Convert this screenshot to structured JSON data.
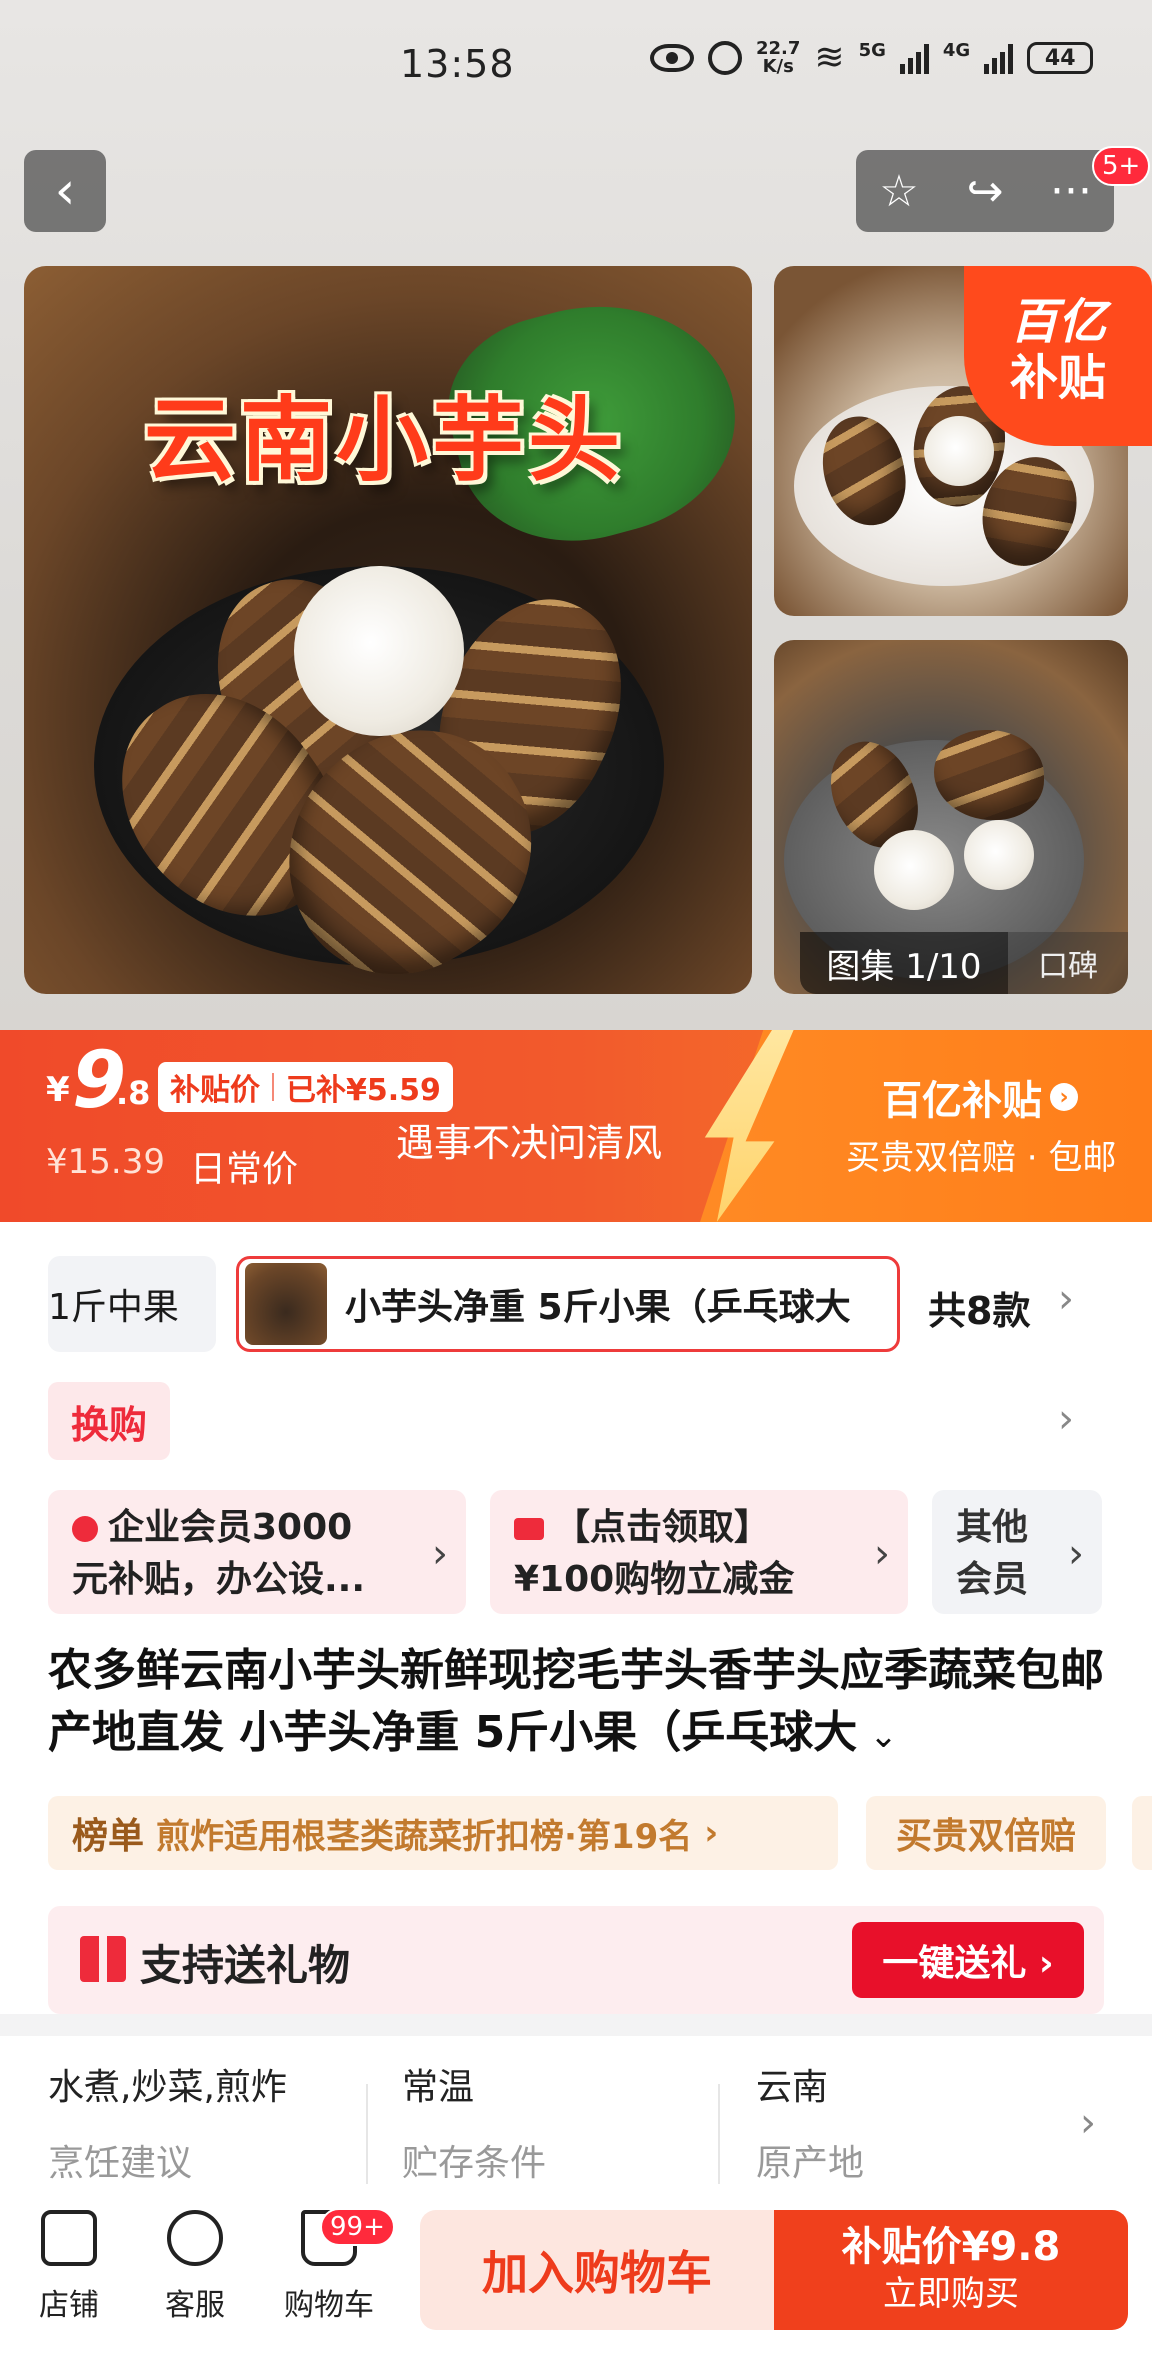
{
  "status_bar": {
    "time": "13:58",
    "net_speed_value": "22.7",
    "net_speed_unit": "K/s",
    "sig1_label": "5G",
    "sig2_label": "4G",
    "battery": "44"
  },
  "header": {
    "back_icon": "‹",
    "favorite_icon": "☆",
    "share_icon": "↪",
    "more_icon": "···",
    "notification_badge": "5+"
  },
  "gallery": {
    "main_image_title": "云南小芋头",
    "subsidy_corner_line1": "百亿",
    "subsidy_corner_line2": "补贴",
    "counter": "图集 1/10",
    "reviews_tab": "口碑"
  },
  "price_banner": {
    "currency": "¥",
    "price_int": "9",
    "price_frac": ".8",
    "subsidy_price_label": "补贴价",
    "subsidy_amount": "已补¥5.59",
    "original_price": "¥15.39",
    "original_label": "日常价",
    "slogan": "遇事不决问清风",
    "program_title": "百亿补贴",
    "program_sub": "买贵双倍赔 · 包邮",
    "accent": "#f04a2a"
  },
  "sku": {
    "option_a": "1斤中果",
    "option_b": "小芋头净重 5斤小果（乒乓球大",
    "count": "共8款",
    "chevron": "›"
  },
  "swap": {
    "label": "换购"
  },
  "coupons": [
    {
      "line1": "企业会员3000",
      "line2": "元补贴，办公设..."
    },
    {
      "line1": "【点击领取】",
      "line2": "¥100购物立减金"
    },
    {
      "line1": "其他",
      "line2": "会员"
    }
  ],
  "product": {
    "title": "农多鲜云南小芋头新鲜现挖毛芋头香芋头应季蔬菜包邮产地直发 小芋头净重 5斤小果（乒乓球大",
    "expand_icon": "⌄"
  },
  "badges": {
    "rank_label": "榜单",
    "rank_text": "煎炸适用根茎类蔬菜折扣榜·第19名",
    "double_comp": "买贵双倍赔"
  },
  "gift": {
    "label": "支持送礼物",
    "button": "一键送礼 ›"
  },
  "specs": [
    {
      "value": "水煮,炒菜,煎炸",
      "key": "烹饪建议"
    },
    {
      "value": "常温",
      "key": "贮存条件"
    },
    {
      "value": "云南",
      "key": "原产地"
    }
  ],
  "bottom_nav": {
    "shop": "店铺",
    "service": "客服",
    "cart": "购物车",
    "cart_badge": "99+",
    "add_to_cart": "加入购物车",
    "buy_price": "补贴价¥9.8",
    "buy_now": "立即购买"
  }
}
